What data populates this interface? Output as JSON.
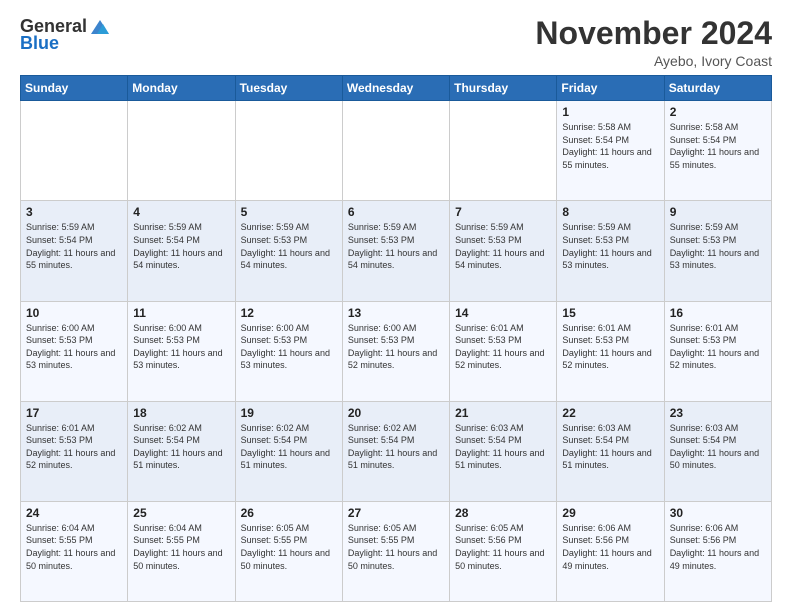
{
  "header": {
    "logo_general": "General",
    "logo_blue": "Blue",
    "month_title": "November 2024",
    "location": "Ayebo, Ivory Coast"
  },
  "days_of_week": [
    "Sunday",
    "Monday",
    "Tuesday",
    "Wednesday",
    "Thursday",
    "Friday",
    "Saturday"
  ],
  "weeks": [
    [
      {
        "day": "",
        "info": ""
      },
      {
        "day": "",
        "info": ""
      },
      {
        "day": "",
        "info": ""
      },
      {
        "day": "",
        "info": ""
      },
      {
        "day": "",
        "info": ""
      },
      {
        "day": "1",
        "info": "Sunrise: 5:58 AM\nSunset: 5:54 PM\nDaylight: 11 hours and 55 minutes."
      },
      {
        "day": "2",
        "info": "Sunrise: 5:58 AM\nSunset: 5:54 PM\nDaylight: 11 hours and 55 minutes."
      }
    ],
    [
      {
        "day": "3",
        "info": "Sunrise: 5:59 AM\nSunset: 5:54 PM\nDaylight: 11 hours and 55 minutes."
      },
      {
        "day": "4",
        "info": "Sunrise: 5:59 AM\nSunset: 5:54 PM\nDaylight: 11 hours and 54 minutes."
      },
      {
        "day": "5",
        "info": "Sunrise: 5:59 AM\nSunset: 5:53 PM\nDaylight: 11 hours and 54 minutes."
      },
      {
        "day": "6",
        "info": "Sunrise: 5:59 AM\nSunset: 5:53 PM\nDaylight: 11 hours and 54 minutes."
      },
      {
        "day": "7",
        "info": "Sunrise: 5:59 AM\nSunset: 5:53 PM\nDaylight: 11 hours and 54 minutes."
      },
      {
        "day": "8",
        "info": "Sunrise: 5:59 AM\nSunset: 5:53 PM\nDaylight: 11 hours and 53 minutes."
      },
      {
        "day": "9",
        "info": "Sunrise: 5:59 AM\nSunset: 5:53 PM\nDaylight: 11 hours and 53 minutes."
      }
    ],
    [
      {
        "day": "10",
        "info": "Sunrise: 6:00 AM\nSunset: 5:53 PM\nDaylight: 11 hours and 53 minutes."
      },
      {
        "day": "11",
        "info": "Sunrise: 6:00 AM\nSunset: 5:53 PM\nDaylight: 11 hours and 53 minutes."
      },
      {
        "day": "12",
        "info": "Sunrise: 6:00 AM\nSunset: 5:53 PM\nDaylight: 11 hours and 53 minutes."
      },
      {
        "day": "13",
        "info": "Sunrise: 6:00 AM\nSunset: 5:53 PM\nDaylight: 11 hours and 52 minutes."
      },
      {
        "day": "14",
        "info": "Sunrise: 6:01 AM\nSunset: 5:53 PM\nDaylight: 11 hours and 52 minutes."
      },
      {
        "day": "15",
        "info": "Sunrise: 6:01 AM\nSunset: 5:53 PM\nDaylight: 11 hours and 52 minutes."
      },
      {
        "day": "16",
        "info": "Sunrise: 6:01 AM\nSunset: 5:53 PM\nDaylight: 11 hours and 52 minutes."
      }
    ],
    [
      {
        "day": "17",
        "info": "Sunrise: 6:01 AM\nSunset: 5:53 PM\nDaylight: 11 hours and 52 minutes."
      },
      {
        "day": "18",
        "info": "Sunrise: 6:02 AM\nSunset: 5:54 PM\nDaylight: 11 hours and 51 minutes."
      },
      {
        "day": "19",
        "info": "Sunrise: 6:02 AM\nSunset: 5:54 PM\nDaylight: 11 hours and 51 minutes."
      },
      {
        "day": "20",
        "info": "Sunrise: 6:02 AM\nSunset: 5:54 PM\nDaylight: 11 hours and 51 minutes."
      },
      {
        "day": "21",
        "info": "Sunrise: 6:03 AM\nSunset: 5:54 PM\nDaylight: 11 hours and 51 minutes."
      },
      {
        "day": "22",
        "info": "Sunrise: 6:03 AM\nSunset: 5:54 PM\nDaylight: 11 hours and 51 minutes."
      },
      {
        "day": "23",
        "info": "Sunrise: 6:03 AM\nSunset: 5:54 PM\nDaylight: 11 hours and 50 minutes."
      }
    ],
    [
      {
        "day": "24",
        "info": "Sunrise: 6:04 AM\nSunset: 5:55 PM\nDaylight: 11 hours and 50 minutes."
      },
      {
        "day": "25",
        "info": "Sunrise: 6:04 AM\nSunset: 5:55 PM\nDaylight: 11 hours and 50 minutes."
      },
      {
        "day": "26",
        "info": "Sunrise: 6:05 AM\nSunset: 5:55 PM\nDaylight: 11 hours and 50 minutes."
      },
      {
        "day": "27",
        "info": "Sunrise: 6:05 AM\nSunset: 5:55 PM\nDaylight: 11 hours and 50 minutes."
      },
      {
        "day": "28",
        "info": "Sunrise: 6:05 AM\nSunset: 5:56 PM\nDaylight: 11 hours and 50 minutes."
      },
      {
        "day": "29",
        "info": "Sunrise: 6:06 AM\nSunset: 5:56 PM\nDaylight: 11 hours and 49 minutes."
      },
      {
        "day": "30",
        "info": "Sunrise: 6:06 AM\nSunset: 5:56 PM\nDaylight: 11 hours and 49 minutes."
      }
    ]
  ]
}
